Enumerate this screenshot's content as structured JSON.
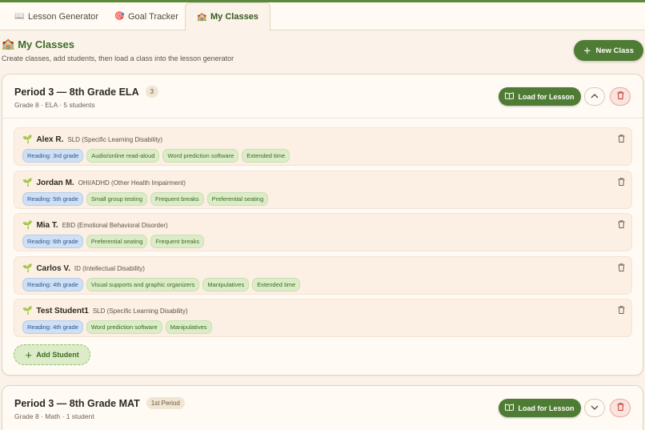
{
  "tabs": [
    {
      "icon": "📖",
      "label": "Lesson Generator"
    },
    {
      "icon": "🎯",
      "label": "Goal Tracker"
    },
    {
      "icon": "🏫",
      "label": "My Classes"
    }
  ],
  "header": {
    "icon": "🏫",
    "title": "My Classes",
    "subtitle": "Create classes, add students, then load a class into the lesson generator",
    "new_class_label": "New Class"
  },
  "classes": [
    {
      "title": "Period 3 — 8th Grade ELA",
      "badge": "3",
      "meta": "Grade 8 · ELA · 5 students",
      "load_label": "Load for Lesson",
      "students": [
        {
          "name": "Alex R.",
          "disability": "SLD (Specific Learning Disability)",
          "reading": "Reading: 3rd grade",
          "accommodations": [
            "Audio/online read-aloud",
            "Word prediction software",
            "Extended time"
          ]
        },
        {
          "name": "Jordan M.",
          "disability": "OHI/ADHD (Other Health Impairment)",
          "reading": "Reading: 5th grade",
          "accommodations": [
            "Small group testing",
            "Frequent breaks",
            "Preferential seating"
          ]
        },
        {
          "name": "Mia T.",
          "disability": "EBD (Emotional Behavioral Disorder)",
          "reading": "Reading: 6th grade",
          "accommodations": [
            "Preferential seating",
            "Frequent breaks"
          ]
        },
        {
          "name": "Carlos V.",
          "disability": "ID (Intellectual Disability)",
          "reading": "Reading: 4th grade",
          "accommodations": [
            "Visual supports and graphic organizers",
            "Manipulatives",
            "Extended time"
          ]
        },
        {
          "name": "Test Student1",
          "disability": "SLD (Specific Learning Disability)",
          "reading": "Reading: 4th grade",
          "accommodations": [
            "Word prediction software",
            "Manipulatives"
          ]
        }
      ],
      "add_student_label": "Add Student"
    },
    {
      "title": "Period 3 — 8th Grade MAT",
      "badge": "1st Period",
      "meta": "Grade 8 · Math · 1 student",
      "load_label": "Load for Lesson"
    }
  ]
}
